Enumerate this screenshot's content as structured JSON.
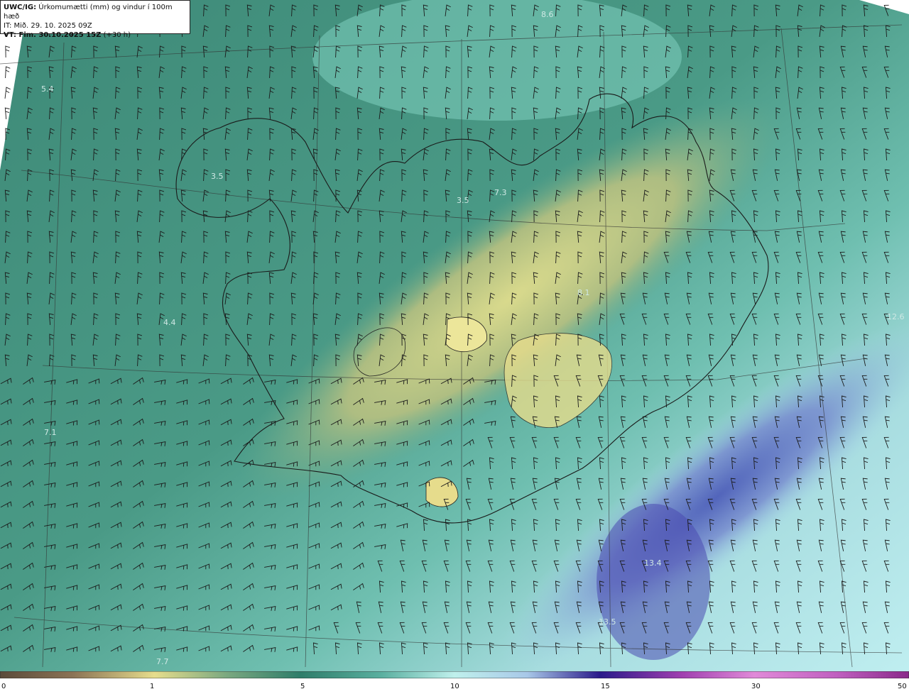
{
  "header": {
    "model_label": "UWC/IG:",
    "title": "Úrkomumætti (mm) og vindur í 100m hæð",
    "it_line": "IT: Mið. 29. 10. 2025 09Z",
    "vt_label": "VT: Fim. 30.10.2025 15Z",
    "vt_suffix": "(+30 h)"
  },
  "colorbar": {
    "ticks": [
      "0",
      "1",
      "5",
      "10",
      "15",
      "30",
      "50"
    ],
    "colors": [
      "#5a4a3a",
      "#8b7355",
      "#b8a066",
      "#e6dd8c",
      "#5aa88c",
      "#2e7d6a",
      "#7fcfc0",
      "#bff0ec",
      "#a8c8e8",
      "#4a5ab8",
      "#2a1a8a",
      "#c04ab8",
      "#e08ad8",
      "#8a2a8a"
    ]
  },
  "values": [
    "8.6",
    "5.4",
    "3.5",
    "3.5",
    "7.3",
    "4.4",
    "7.1",
    "12.6",
    "13.4",
    "13.5",
    "7.7",
    "8.1"
  ],
  "icons": [
    "wind-barb-icon"
  ]
}
